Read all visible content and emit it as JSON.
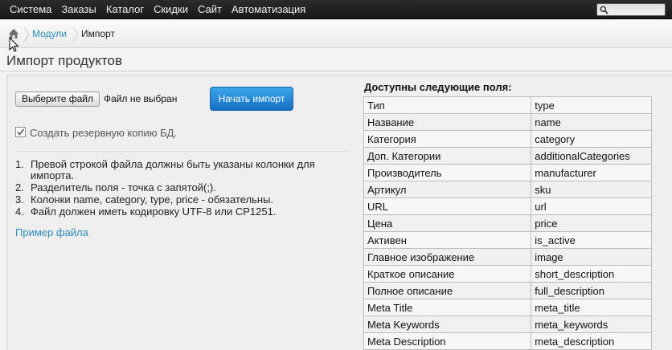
{
  "topbar": {
    "menu": [
      "Система",
      "Заказы",
      "Каталог",
      "Скидки",
      "Сайт",
      "Автоматизация"
    ],
    "search": {
      "icon": "search-icon"
    }
  },
  "breadcrumb": {
    "home_icon": "home-icon",
    "link": "Модули",
    "current": "Импорт"
  },
  "page": {
    "title": "Импорт продуктов"
  },
  "form": {
    "file_button": "Выберите файл",
    "file_status": "Файл не выбран",
    "start_button": "Начать импорт",
    "backup_label": "Создать резервную копию БД.",
    "backup_checked": true
  },
  "instructions": [
    {
      "num": "1.",
      "text": "Превой строкой файла должны быть указаны колонки для импорта."
    },
    {
      "num": "2.",
      "text": "Разделитель поля - точка с запятой(;)."
    },
    {
      "num": "3.",
      "text": "Колонки name, category, type, price - обязательны."
    },
    {
      "num": "4.",
      "text": "Файл должен иметь кодировку UTF-8 или CP1251."
    }
  ],
  "example_link": "Пример файла",
  "fields": {
    "heading": "Доступны следующие поля:",
    "rows": [
      [
        "Тип",
        "type"
      ],
      [
        "Название",
        "name"
      ],
      [
        "Категория",
        "category"
      ],
      [
        "Доп. Категории",
        "additionalCategories"
      ],
      [
        "Производитель",
        "manufacturer"
      ],
      [
        "Артикул",
        "sku"
      ],
      [
        "URL",
        "url"
      ],
      [
        "Цена",
        "price"
      ],
      [
        "Активен",
        "is_active"
      ],
      [
        "Главное изображение",
        "image"
      ],
      [
        "Краткое описание",
        "short_description"
      ],
      [
        "Полное описание",
        "full_description"
      ],
      [
        "Meta Title",
        "meta_title"
      ],
      [
        "Meta Keywords",
        "meta_keywords"
      ],
      [
        "Meta Description",
        "meta_description"
      ]
    ]
  },
  "colors": {
    "topbar_bg": "#1f1f1f",
    "link": "#2a8bbf",
    "primary_button": "#1f86d6"
  }
}
